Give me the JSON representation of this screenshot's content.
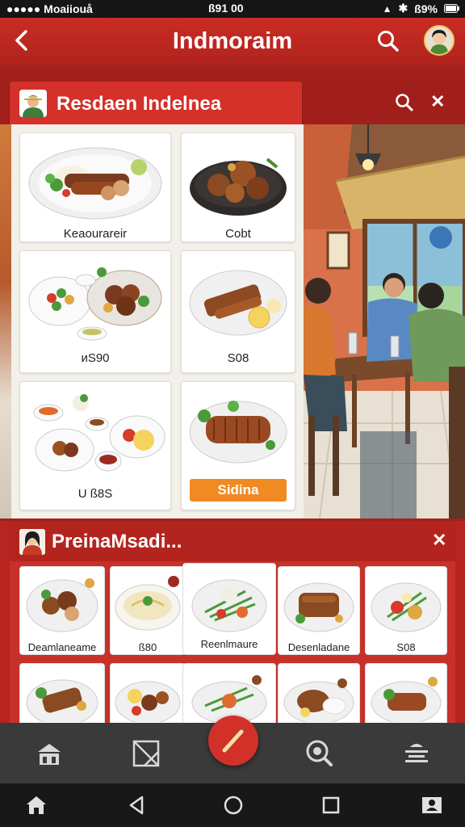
{
  "status_bar": {
    "carrier": "●●●●● Moaiiouå",
    "time": "ß91 00",
    "battery": "ß9%"
  },
  "app_bar": {
    "title": "Indmoraim"
  },
  "restaurant": {
    "title": "Resdaen Indelnea"
  },
  "menu": {
    "items": [
      {
        "label": "Keaourareir"
      },
      {
        "label": "Cobt"
      },
      {
        "label": "ᴎS90"
      },
      {
        "label": "S08"
      },
      {
        "label": "U ß8S"
      }
    ],
    "order_button": "Sidina"
  },
  "recommendations": {
    "title": "PreinaMsadi...",
    "items": [
      {
        "label": "Deamlaneame"
      },
      {
        "label": "ß80"
      },
      {
        "label": "Reenlmaure"
      },
      {
        "label": "Desenladane"
      },
      {
        "label": "S08"
      }
    ]
  },
  "colors": {
    "primary": "#c92c24",
    "dark_red": "#a3211c",
    "accent_orange": "#f18a22",
    "bottom_bar": "#3a3a3a"
  },
  "icons": {
    "back": "chevron-left-icon",
    "search": "search-icon",
    "close": "close-icon",
    "home": "home-icon",
    "edit": "pencil-icon",
    "location": "location-icon"
  }
}
